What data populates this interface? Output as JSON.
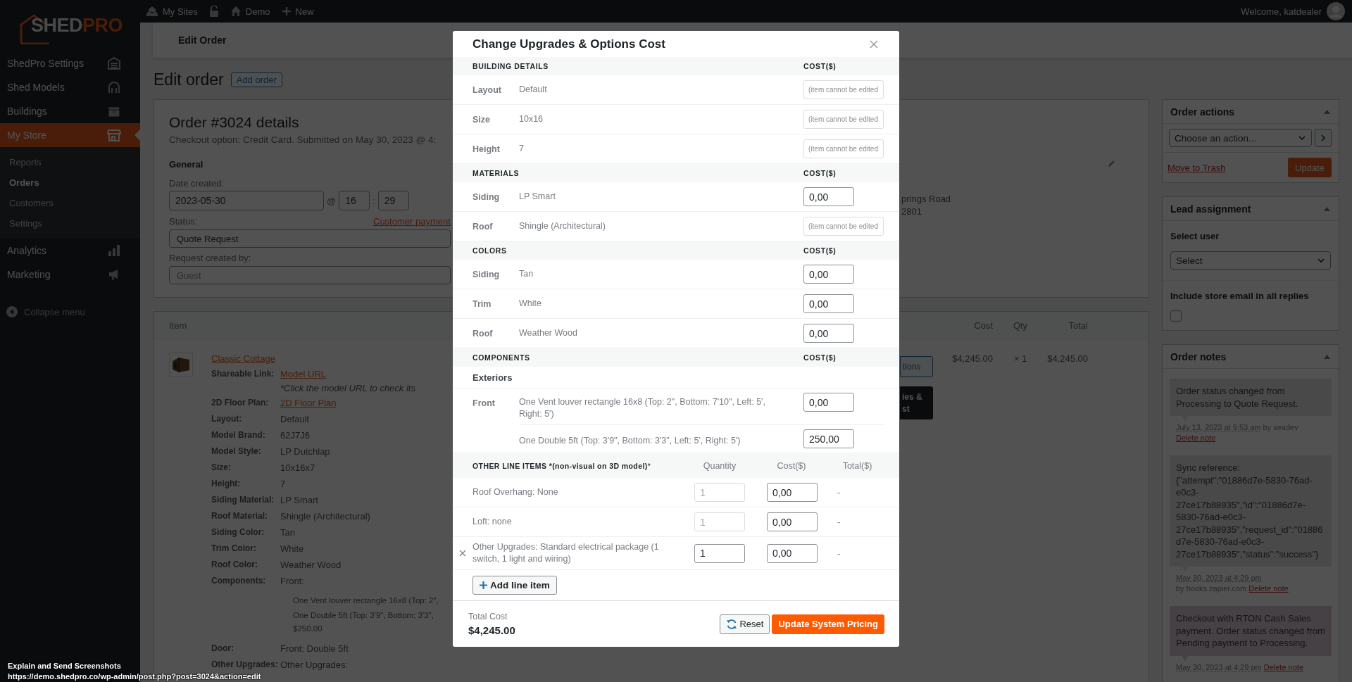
{
  "logo": {
    "word": "SHED",
    "accent": "PRO"
  },
  "sidebar": {
    "items": [
      {
        "label": "ShedPro Settings",
        "selected": false
      },
      {
        "label": "Shed Models",
        "selected": false
      },
      {
        "label": "Buildings",
        "selected": false
      },
      {
        "label": "My Store",
        "selected": true,
        "children": [
          {
            "label": "Reports",
            "selected": false
          },
          {
            "label": "Orders",
            "selected": true
          },
          {
            "label": "Customers",
            "selected": false
          },
          {
            "label": "Settings",
            "selected": false
          }
        ]
      },
      {
        "label": "Analytics",
        "selected": false
      },
      {
        "label": "Marketing",
        "selected": false
      }
    ],
    "collapse": "Collapse menu"
  },
  "topbar": {
    "items": [
      {
        "kind": "sites",
        "label": "My Sites"
      },
      {
        "kind": "lock"
      },
      {
        "kind": "home",
        "label": "Demo"
      },
      {
        "kind": "new",
        "label": "New"
      }
    ],
    "welcome": "Welcome, katdealer"
  },
  "page": {
    "header": "Edit Order",
    "title": "Edit order",
    "add_button": "Add order"
  },
  "order": {
    "title": "Order #3024 details",
    "subtitle": "Checkout option: Credit Card. Submitted on May 30, 2023 @ 4:",
    "general": {
      "heading": "General",
      "date_label": "Date created:",
      "date": "2023-05-30",
      "at": "@",
      "hour": "16",
      "colon": ":",
      "minute": "29",
      "status_label": "Status:",
      "payment_link": "Customer payment",
      "status": "Quote Request",
      "created_by_label": "Request created by:",
      "created_by": "Guest"
    },
    "address": [
      "prings Road",
      "2801"
    ]
  },
  "items": {
    "columns": [
      "Item",
      "Cost",
      "Qty",
      "Total"
    ],
    "row": {
      "name": "Classic Cottage",
      "cost": "$4,245.00",
      "qty": "× 1",
      "total": "$4,245.00",
      "details": [
        {
          "kind": "link",
          "label": "Shareable Link:",
          "value": "Model URL",
          "note": "*Click the model URL to check its"
        },
        {
          "kind": "link",
          "label": "2D Floor Plan:",
          "value": "2D Floor Plan"
        },
        {
          "kind": "text",
          "label": "Layout:",
          "value": "Default"
        },
        {
          "kind": "text",
          "label": "Model Brand:",
          "value": "62J7J6"
        },
        {
          "kind": "text",
          "label": "Model Style:",
          "value": "LP Dutchlap"
        },
        {
          "kind": "text",
          "label": "Size:",
          "value": "10x16x7"
        },
        {
          "kind": "text",
          "label": "Height:",
          "value": "7"
        },
        {
          "kind": "text",
          "label": "Siding Material:",
          "value": "LP Smart"
        },
        {
          "kind": "text",
          "label": "Roof Material:",
          "value": "Shingle (Architectural)"
        },
        {
          "kind": "text",
          "label": "Siding Color:",
          "value": "Tan"
        },
        {
          "kind": "text",
          "label": "Trim Color:",
          "value": "White"
        },
        {
          "kind": "text",
          "label": "Roof Color:",
          "value": "Weather Wood"
        },
        {
          "kind": "text",
          "label": "Components:",
          "value": "Front:",
          "lines": [
            "One Vent louver rectangle 16x8 (Top: 2\",",
            "One Double 5ft (Top: 3'9\", Bottom: 3'3\",",
            "$250.00"
          ]
        },
        {
          "kind": "text",
          "label": "Door:",
          "value": "Front: Double 5ft"
        },
        {
          "kind": "text",
          "label": "Other Upgrades:",
          "value": "Other Upgrades:"
        }
      ],
      "cut_buttons": [
        {
          "kind": "outline",
          "lines": [
            "tions"
          ]
        },
        {
          "kind": "dark",
          "lines": [
            "ies &",
            "st"
          ]
        }
      ]
    }
  },
  "order_actions": {
    "title": "Order actions",
    "select": "Choose an action...",
    "trash": "Move to Trash",
    "update": "Update"
  },
  "lead": {
    "title": "Lead assignment",
    "select_label": "Select user",
    "select": "Select",
    "email_label": "Include store email in all replies",
    "email_checked": false
  },
  "notes": {
    "title": "Order notes",
    "items": [
      {
        "kind": "private",
        "text": "Order status changed from Processing to Quote Request.",
        "date": "July 13, 2023 at 9:53 am",
        "by": "by seadev",
        "delete": "Delete note"
      },
      {
        "kind": "private",
        "text": "Sync reference: {\"attempt\":\"01886d7e-5830-76ad-e0c3-27ce17b88935\",\"id\":\"01886d7e-5830-76ad-e0c3-27ce17b88935\",\"request_id\":\"01886d7e-5830-76ad-e0c3-27ce17b88935\",\"status\":\"success\"}",
        "date": "May 30, 2023 at 4:29 pm",
        "by": "by hooks.zapier.com",
        "delete": "Delete note"
      },
      {
        "kind": "system",
        "text": "Checkout with RTON Cash Sales payment. Order status changed from Pending payment to Processing.",
        "date": "May 30, 2023 at 4:29 pm",
        "delete": "Delete note"
      }
    ]
  },
  "modal": {
    "title": "Change Upgrades & Options Cost",
    "sections": [
      {
        "kind": "details",
        "heading": "BUILDING DETAILS",
        "cost_heading": "COST($)",
        "rows": [
          {
            "label": "Layout",
            "value": "Default",
            "editable": false,
            "placeholder": "(item cannot be edited"
          },
          {
            "label": "Size",
            "value": "10x16",
            "editable": false,
            "placeholder": "(item cannot be edited"
          },
          {
            "label": "Height",
            "value": "7",
            "editable": false,
            "placeholder": "(item cannot be edited"
          }
        ]
      },
      {
        "kind": "details",
        "heading": "MATERIALS",
        "cost_heading": "COST($)",
        "rows": [
          {
            "label": "Siding",
            "value": "LP Smart",
            "editable": true,
            "cost": "0,00"
          },
          {
            "label": "Roof",
            "value": "Shingle (Architectural)",
            "editable": false,
            "placeholder": "(item cannot be edited"
          }
        ]
      },
      {
        "kind": "details",
        "heading": "COLORS",
        "cost_heading": "COST($)",
        "rows": [
          {
            "label": "Siding",
            "value": "Tan",
            "editable": true,
            "cost": "0,00"
          },
          {
            "label": "Trim",
            "value": "White",
            "editable": true,
            "cost": "0,00"
          },
          {
            "label": "Roof",
            "value": "Weather Wood",
            "editable": true,
            "cost": "0,00"
          }
        ]
      },
      {
        "kind": "components",
        "heading": "COMPONENTS",
        "cost_heading": "COST($)",
        "groups": [
          {
            "title": "Exteriors",
            "rows": [
              {
                "label": "Front",
                "items": [
                  {
                    "text": "One Vent louver rectangle 16x8 (Top: 2\", Bottom: 7'10\", Left: 5', Right: 5')",
                    "cost": "0,00"
                  },
                  {
                    "text": "One Double 5ft (Top: 3'9\", Bottom: 3'3\", Left: 5', Right: 5')",
                    "cost": "250,00"
                  }
                ]
              }
            ]
          }
        ]
      }
    ],
    "line_items": {
      "heading": "**OTHER LINE ITEMS** ***(non-visual on 3D model)***",
      "columns": [
        "Quantity",
        "Cost($)",
        "Total($)"
      ],
      "rows": [
        {
          "text": "Roof Overhang: None",
          "qty": "1",
          "qty_disabled": true,
          "cost": "0,00",
          "total": "-",
          "removable": false
        },
        {
          "text": "Loft: none",
          "qty": "1",
          "qty_disabled": true,
          "cost": "0,00",
          "total": "-",
          "removable": false
        },
        {
          "text": "Other Upgrades: Standard electrical package (1 switch, 1 light and wiring)",
          "qty": "1",
          "qty_disabled": false,
          "cost": "0,00",
          "total": "-",
          "removable": true
        }
      ],
      "add": "Add line item"
    },
    "footer": {
      "total_label": "Total Cost",
      "total": "$4,245.00",
      "reset": "Reset",
      "update": "Update System Pricing"
    }
  },
  "caption": {
    "title": "Explain and Send Screenshots",
    "url": "https://demo.shedpro.co/wp-admin/post.php?post=3024&action=edit"
  }
}
